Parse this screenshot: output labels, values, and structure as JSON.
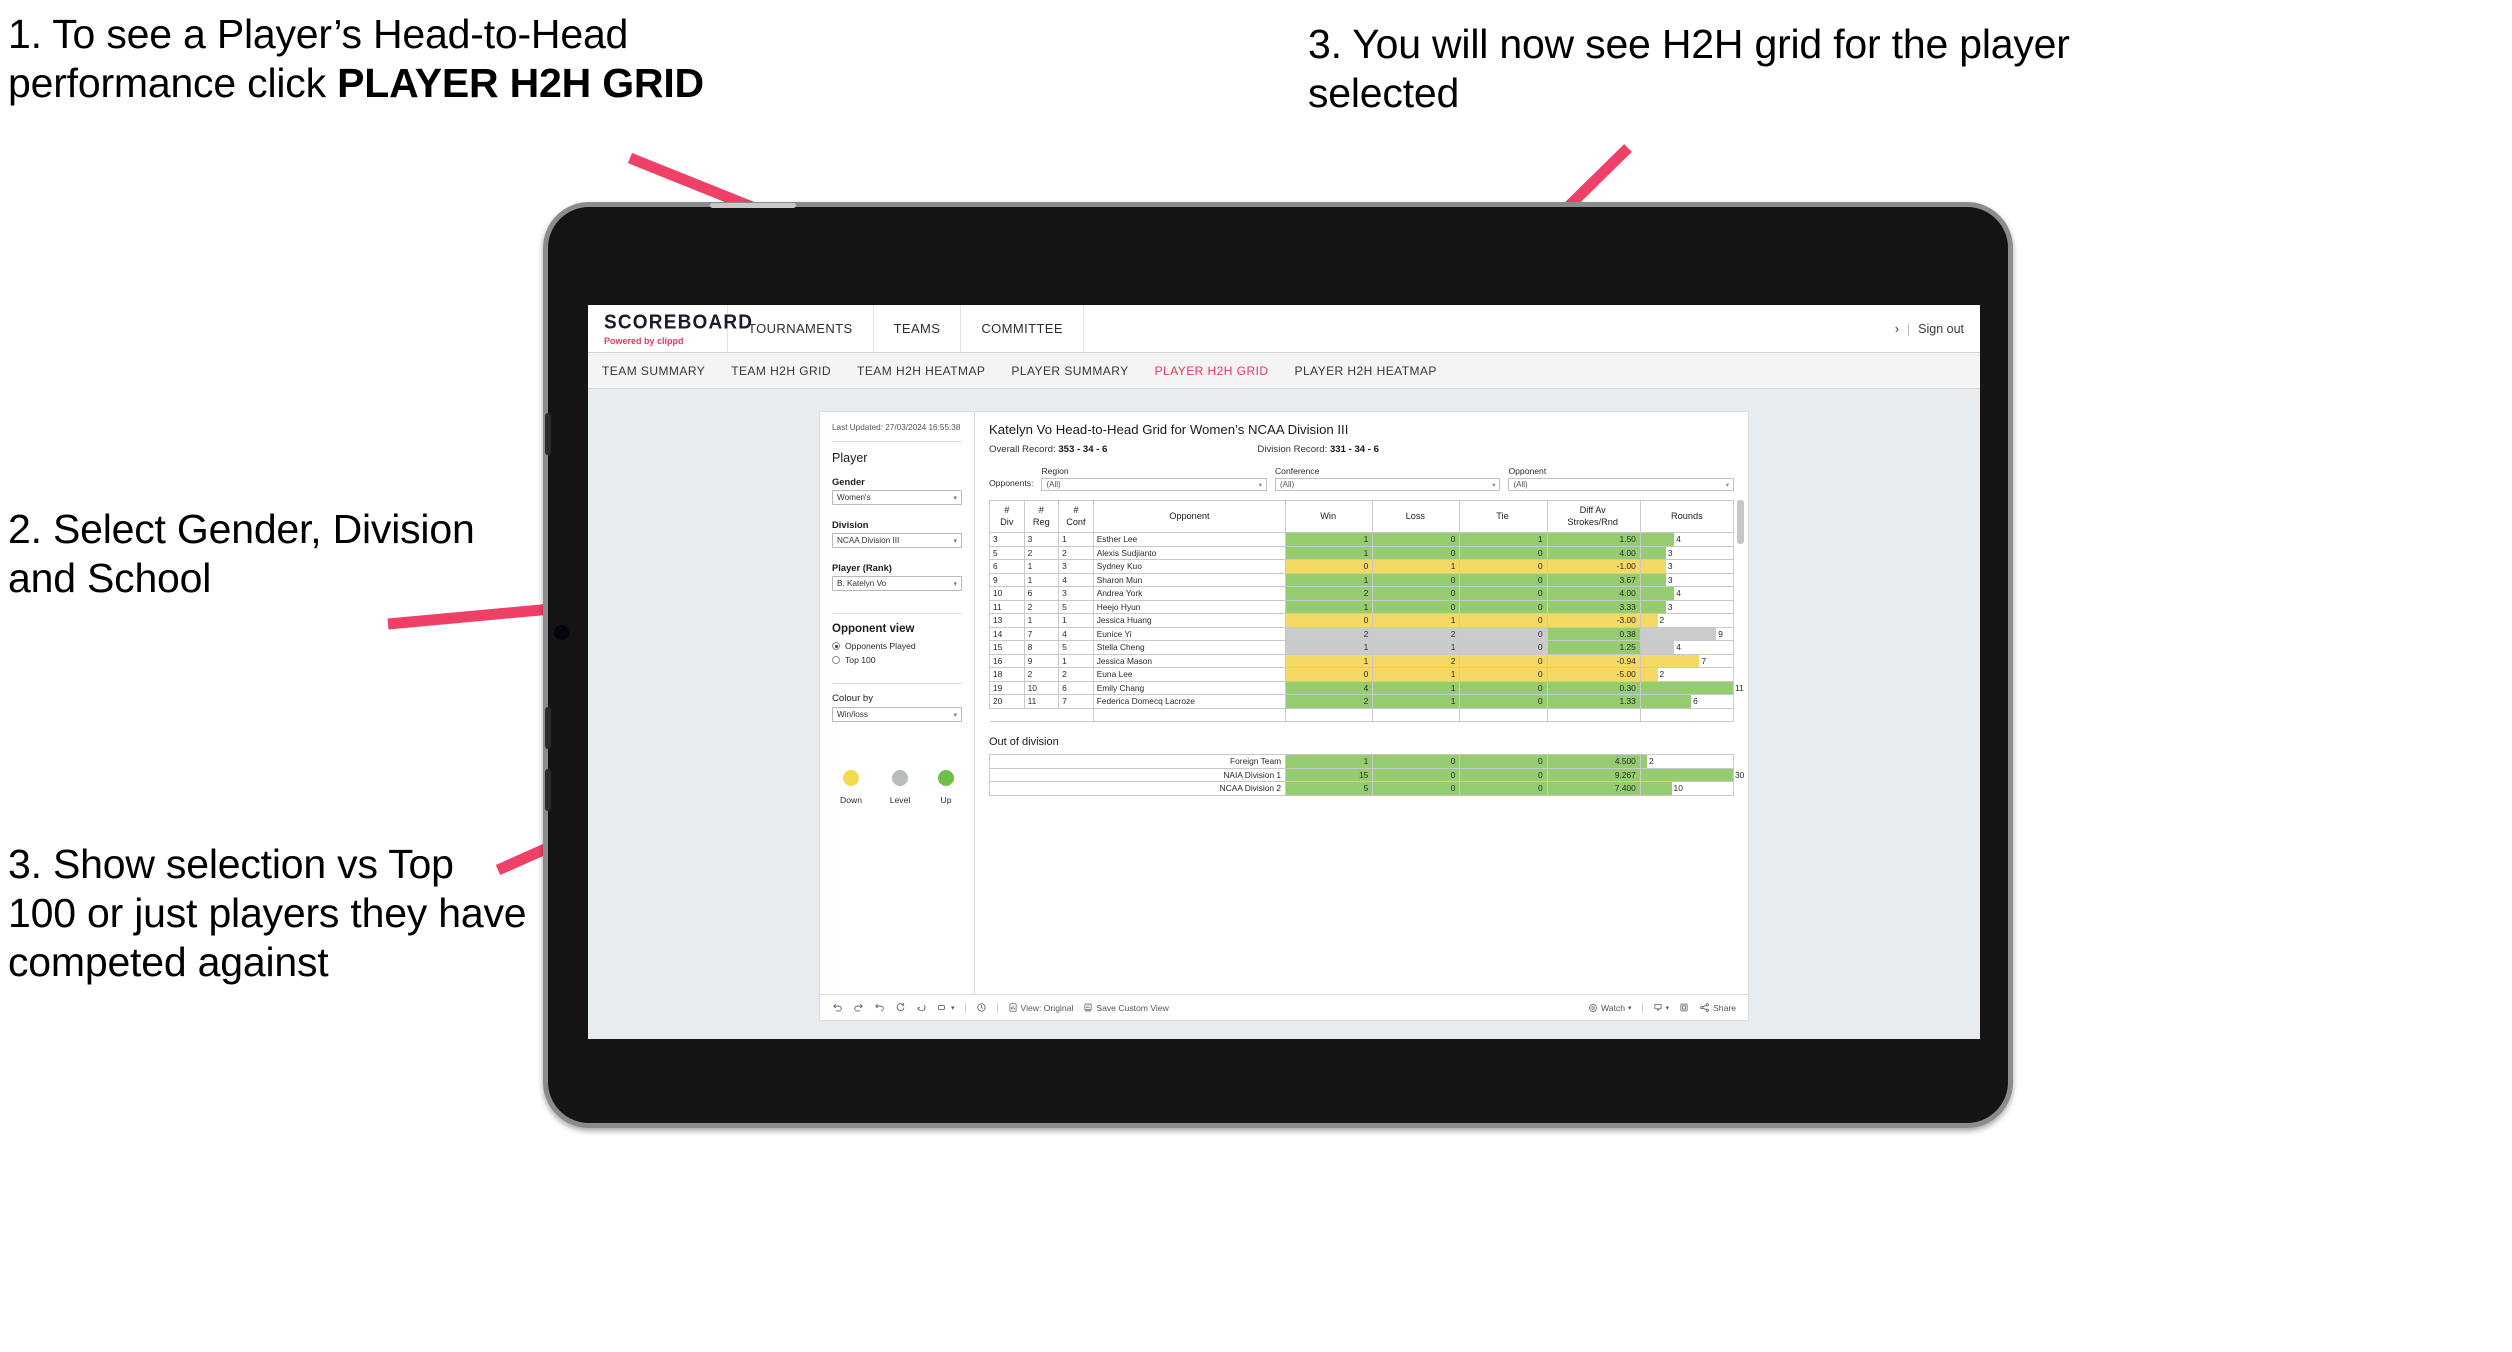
{
  "annotations": [
    {
      "id": "a1",
      "pre": "1. To see a Player’s Head-to-Head performance click ",
      "bold": "PLAYER H2H GRID"
    },
    {
      "id": "a2",
      "text": "2. Select Gender, Division and School"
    },
    {
      "id": "a3",
      "text": "3. Show selection vs Top 100 or just players they have competed against"
    },
    {
      "id": "a4",
      "text": "3. You will now see H2H grid for the player selected"
    }
  ],
  "header": {
    "brand_name": "SCOREBOARD",
    "brand_sub_prefix": "Powered by ",
    "brand_sub_accent": "clippd",
    "nav": [
      "TOURNAMENTS",
      "TEAMS",
      "COMMITTEE"
    ],
    "chevron": "›",
    "separator": "|",
    "sign_out": "Sign out"
  },
  "tabs": [
    {
      "label": "TEAM SUMMARY",
      "active": false
    },
    {
      "label": "TEAM H2H GRID",
      "active": false
    },
    {
      "label": "TEAM H2H HEATMAP",
      "active": false
    },
    {
      "label": "PLAYER SUMMARY",
      "active": false
    },
    {
      "label": "PLAYER H2H GRID",
      "active": true
    },
    {
      "label": "PLAYER H2H HEATMAP",
      "active": false
    }
  ],
  "panel": {
    "last_updated": "Last Updated: 27/03/2024 16:55:38",
    "player_title": "Player",
    "filters": [
      {
        "label": "Gender",
        "value": "Women's"
      },
      {
        "label": "Division",
        "value": "NCAA Division III"
      },
      {
        "label": "Player (Rank)",
        "value": "B. Katelyn Vo"
      }
    ],
    "opponent_view_title": "Opponent view",
    "opponent_view_options": [
      {
        "label": "Opponents Played",
        "selected": true
      },
      {
        "label": "Top 100",
        "selected": false
      }
    ],
    "colour_by_label": "Colour by",
    "colour_by_value": "Win/loss",
    "legend": [
      {
        "label": "Down",
        "color": "#f3d94e"
      },
      {
        "label": "Level",
        "color": "#b9bcbe"
      },
      {
        "label": "Up",
        "color": "#6fbf4b"
      }
    ]
  },
  "main": {
    "title": "Katelyn Vo Head-to-Head Grid for Women’s NCAA Division III",
    "overall_label": "Overall Record:",
    "overall_value": "353 -  34 - 6",
    "division_label": "Division Record:",
    "division_value": "331 -  34 - 6",
    "opponents_label": "Opponents:",
    "opponent_filters": [
      {
        "label": "Region",
        "value": "(All)"
      },
      {
        "label": "Conference",
        "value": "(All)"
      },
      {
        "label": "Opponent",
        "value": "(All)"
      }
    ],
    "out_of_division_title": "Out of division"
  },
  "chart_data": {
    "type": "table",
    "title": "Katelyn Vo Head-to-Head Grid for Women’s NCAA Division III",
    "columns": [
      "# Div",
      "# Reg",
      "# Conf",
      "Opponent",
      "Win",
      "Loss",
      "Tie",
      "Diff Av Strokes/Rnd",
      "Rounds"
    ],
    "column_headers_multiline": [
      [
        "#",
        "Div"
      ],
      [
        "#",
        "Reg"
      ],
      [
        "#",
        "Conf"
      ],
      [
        "Opponent"
      ],
      [
        "Win"
      ],
      [
        "Loss"
      ],
      [
        "Tie"
      ],
      [
        "Diff Av",
        "Strokes/Rnd"
      ],
      [
        "Rounds"
      ]
    ],
    "rounds_max": 11,
    "rows": [
      {
        "div": "3",
        "reg": "3",
        "conf": "1",
        "opponent": "Esther Lee",
        "win": "1",
        "loss": "0",
        "tie": "1",
        "diff": "1.50",
        "rounds": "4",
        "rounds_val": 4,
        "color": "#96cc70"
      },
      {
        "div": "5",
        "reg": "2",
        "conf": "2",
        "opponent": "Alexis Sudjianto",
        "win": "1",
        "loss": "0",
        "tie": "0",
        "diff": "4.00",
        "rounds": "3",
        "rounds_val": 3,
        "color": "#96cc70"
      },
      {
        "div": "6",
        "reg": "1",
        "conf": "3",
        "opponent": "Sydney Kuo",
        "win": "0",
        "loss": "1",
        "tie": "0",
        "diff": "-1.00",
        "rounds": "3",
        "rounds_val": 3,
        "color": "#f4d964"
      },
      {
        "div": "9",
        "reg": "1",
        "conf": "4",
        "opponent": "Sharon Mun",
        "win": "1",
        "loss": "0",
        "tie": "0",
        "diff": "3.67",
        "rounds": "3",
        "rounds_val": 3,
        "color": "#96cc70"
      },
      {
        "div": "10",
        "reg": "6",
        "conf": "3",
        "opponent": "Andrea York",
        "win": "2",
        "loss": "0",
        "tie": "0",
        "diff": "4.00",
        "rounds": "4",
        "rounds_val": 4,
        "color": "#96cc70"
      },
      {
        "div": "11",
        "reg": "2",
        "conf": "5",
        "opponent": "Heejo Hyun",
        "win": "1",
        "loss": "0",
        "tie": "0",
        "diff": "3.33",
        "rounds": "3",
        "rounds_val": 3,
        "color": "#96cc70"
      },
      {
        "div": "13",
        "reg": "1",
        "conf": "1",
        "opponent": "Jessica Huang",
        "win": "0",
        "loss": "1",
        "tie": "0",
        "diff": "-3.00",
        "rounds": "2",
        "rounds_val": 2,
        "color": "#f4d964"
      },
      {
        "div": "14",
        "reg": "7",
        "conf": "4",
        "opponent": "Eunice Yi",
        "win": "2",
        "loss": "2",
        "tie": "0",
        "diff": "0.38",
        "rounds": "9",
        "rounds_val": 9,
        "color": "#c9cbcd",
        "diff_color": "#96cc70"
      },
      {
        "div": "15",
        "reg": "8",
        "conf": "5",
        "opponent": "Stella Cheng",
        "win": "1",
        "loss": "1",
        "tie": "0",
        "diff": "1.25",
        "rounds": "4",
        "rounds_val": 4,
        "color": "#c9cbcd",
        "diff_color": "#96cc70"
      },
      {
        "div": "16",
        "reg": "9",
        "conf": "1",
        "opponent": "Jessica Mason",
        "win": "1",
        "loss": "2",
        "tie": "0",
        "diff": "-0.94",
        "rounds": "7",
        "rounds_val": 7,
        "color": "#f4d964"
      },
      {
        "div": "18",
        "reg": "2",
        "conf": "2",
        "opponent": "Euna Lee",
        "win": "0",
        "loss": "1",
        "tie": "0",
        "diff": "-5.00",
        "rounds": "2",
        "rounds_val": 2,
        "color": "#f4d964"
      },
      {
        "div": "19",
        "reg": "10",
        "conf": "6",
        "opponent": "Emily Chang",
        "win": "4",
        "loss": "1",
        "tie": "0",
        "diff": "0.30",
        "rounds": "11",
        "rounds_val": 11,
        "color": "#96cc70"
      },
      {
        "div": "20",
        "reg": "11",
        "conf": "7",
        "opponent": "Federica Domecq Lacroze",
        "win": "2",
        "loss": "1",
        "tie": "0",
        "diff": "1.33",
        "rounds": "6",
        "rounds_val": 6,
        "color": "#96cc70"
      }
    ],
    "out_of_division": {
      "rounds_max": 30,
      "rows": [
        {
          "name": "Foreign Team",
          "win": "1",
          "loss": "0",
          "tie": "0",
          "diff": "4.500",
          "rounds": "2",
          "rounds_val": 2,
          "color": "#96cc70"
        },
        {
          "name": "NAIA Division 1",
          "win": "15",
          "loss": "0",
          "tie": "0",
          "diff": "9.267",
          "rounds": "30",
          "rounds_val": 30,
          "color": "#96cc70"
        },
        {
          "name": "NCAA Division 2",
          "win": "5",
          "loss": "0",
          "tie": "0",
          "diff": "7.400",
          "rounds": "10",
          "rounds_val": 10,
          "color": "#96cc70"
        }
      ]
    }
  },
  "toolbar": {
    "view_original": "View: Original",
    "save_custom_view": "Save Custom View",
    "watch": "Watch",
    "share": "Share",
    "caret": "▾"
  },
  "colors": {
    "accent": "#e8385f",
    "green": "#96cc70",
    "yellow": "#f4d964",
    "grey": "#c9cbcd",
    "arrow": "#ef4068"
  }
}
